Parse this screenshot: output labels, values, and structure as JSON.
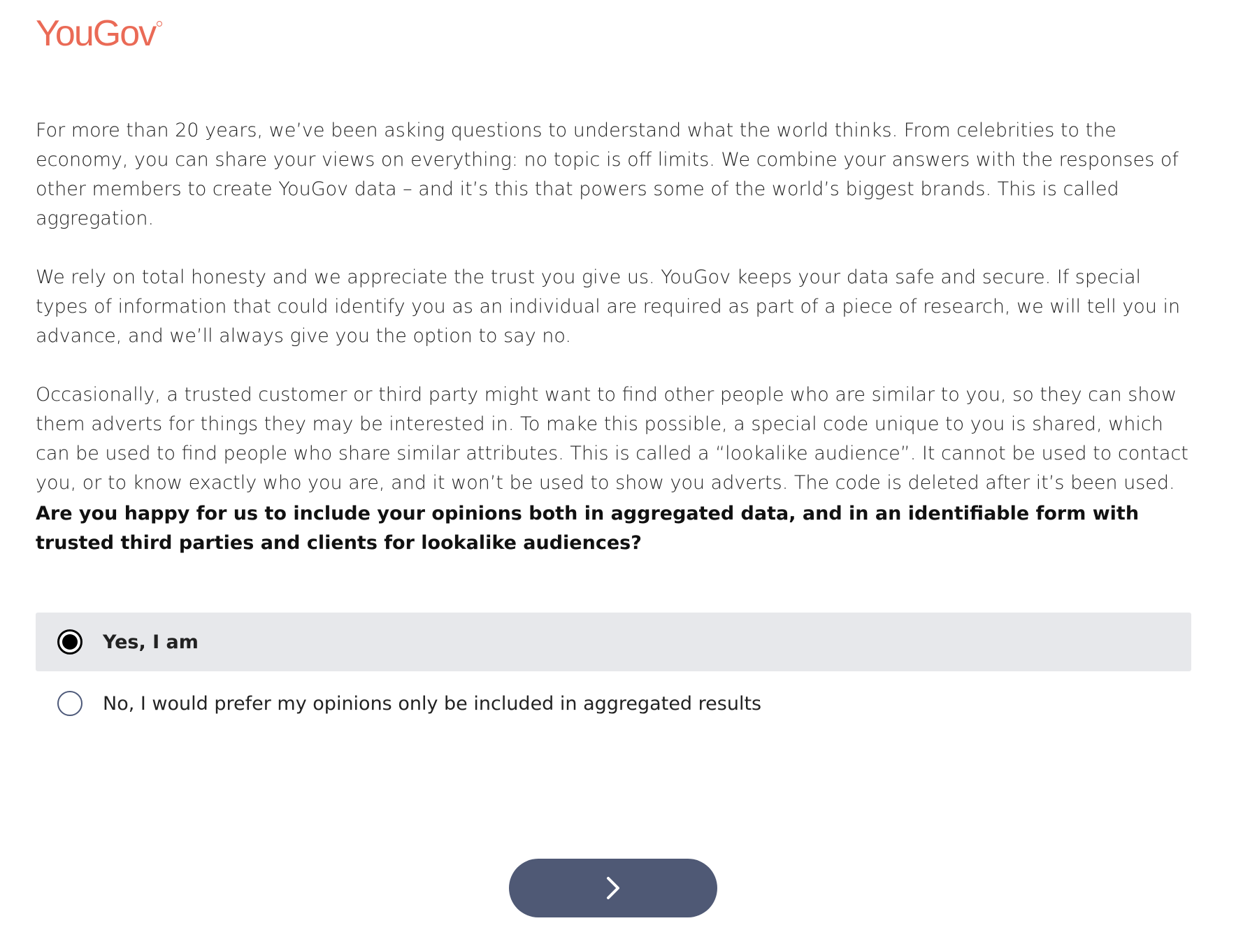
{
  "brand": {
    "logo_text": "YouGov",
    "logo_color": "#ea6a56"
  },
  "intro": {
    "paragraphs": [
      "For more than 20 years, we’ve been asking questions to understand what the world thinks. From celebrities to the economy, you can share your views on everything: no topic is off limits. We combine your answers with the responses of other members to create YouGov data – and it’s this that powers some of the world’s biggest brands. This is called aggregation.",
      "We rely on total honesty and we appreciate the trust you give us. YouGov keeps your data safe and secure. If special types of information that could identify you as an individual are required as part of a piece of research, we will tell you in advance, and we’ll always give you the option to say no.",
      "Occasionally, a trusted customer or third party might want to find other people who are similar to you, so they can show them adverts for things they may be interested in. To make this possible, a special code unique to you is shared, which can be used to find people who share similar attributes. This is called a “lookalike audience”. It cannot be used to contact you, or to know exactly who you are, and it won’t be used to show you adverts. The code is deleted after it’s been used."
    ]
  },
  "question": {
    "text": "Are you happy for us to include your opinions both in aggregated data, and in an identifiable form with trusted third parties and clients for lookalike audiences?"
  },
  "options": [
    {
      "label": "Yes, I am",
      "selected": true
    },
    {
      "label": "No, I would prefer my opinions only be included in aggregated results",
      "selected": false
    }
  ],
  "next_button": {
    "icon": "chevron-right-icon",
    "color": "#4f5975"
  }
}
